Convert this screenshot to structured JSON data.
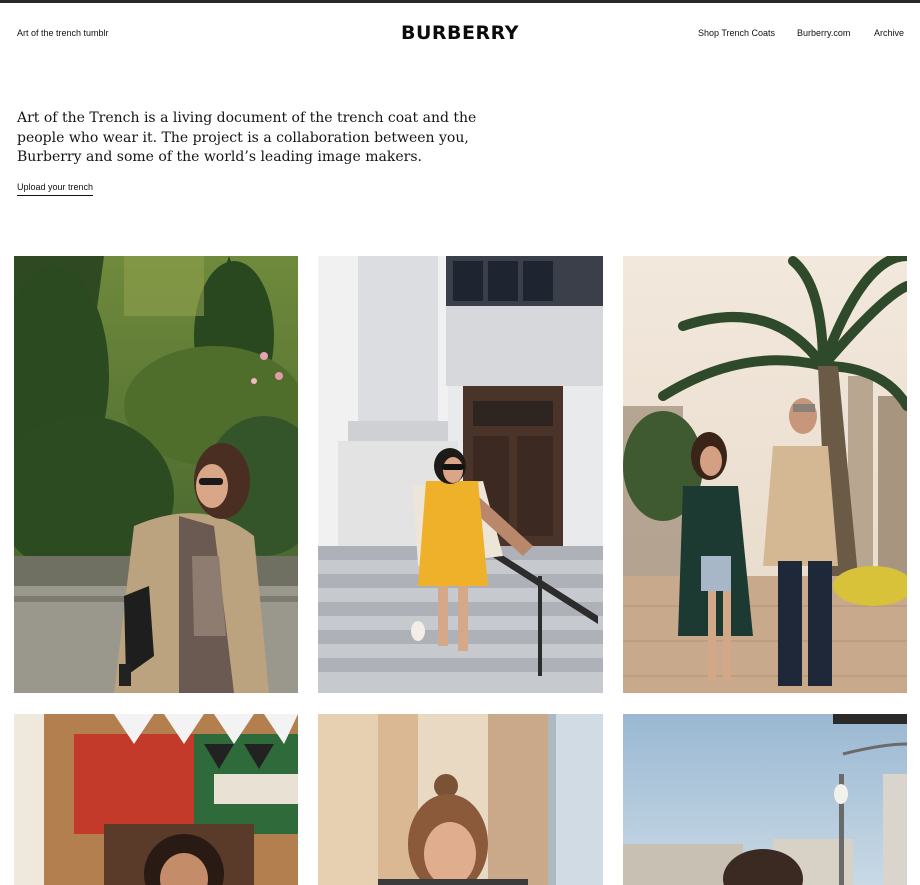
{
  "header": {
    "left_link": "Art of the trench tumblr",
    "logo": "BURBERRY",
    "nav": [
      "Shop Trench Coats",
      "Burberry.com",
      "Archive"
    ]
  },
  "intro": {
    "text": "Art of the Trench is a living document of the trench coat and the people who wear it. The project is a collaboration between you, Burberry and some of the world’s leading image makers.",
    "upload_link": "Upload your trench"
  },
  "gallery": {
    "tiles": [
      {
        "subject": "woman in trench coat in garden"
      },
      {
        "subject": "woman in yellow dress on steps"
      },
      {
        "subject": "couple walking under palm tree"
      },
      {
        "subject": "woman in front of flags"
      },
      {
        "subject": "woman with hair bun"
      },
      {
        "subject": "woman near street lamp"
      }
    ]
  }
}
